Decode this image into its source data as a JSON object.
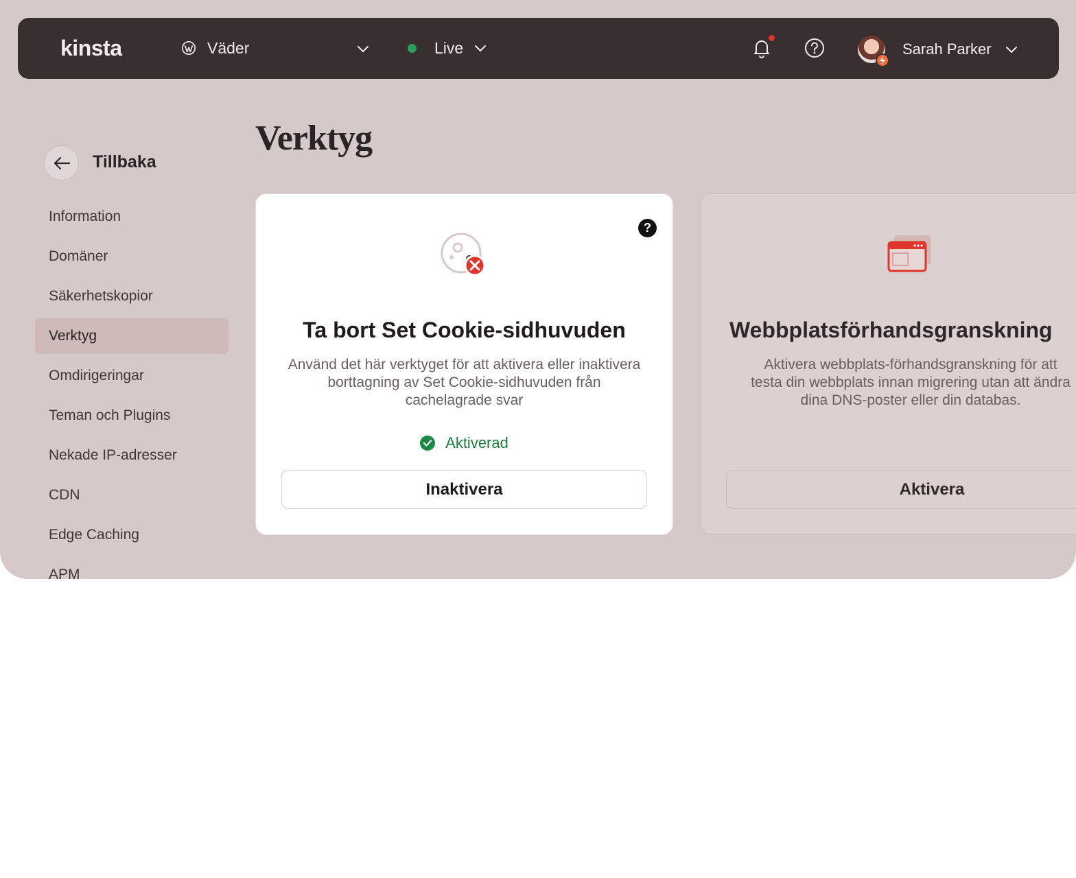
{
  "topbar": {
    "site_name": "Väder",
    "environment": "Live",
    "user_name": "Sarah Parker"
  },
  "sidebar": {
    "back_label": "Tillbaka",
    "items": [
      {
        "label": "Information"
      },
      {
        "label": "Domäner"
      },
      {
        "label": "Säkerhetskopior"
      },
      {
        "label": "Verktyg",
        "active": true
      },
      {
        "label": "Omdirigeringar"
      },
      {
        "label": "Teman och Plugins"
      },
      {
        "label": "Nekade IP-adresser"
      },
      {
        "label": "CDN"
      },
      {
        "label": "Edge Caching"
      },
      {
        "label": "APM"
      }
    ]
  },
  "main": {
    "title": "Verktyg",
    "cards": [
      {
        "title": "Ta bort Set Cookie-sidhuvuden",
        "description": "Använd det här verktyget för att aktivera eller inaktivera borttagning av Set Cookie-sidhuvuden från cachelagrade svar",
        "status": "Aktiverad",
        "button": "Inaktivera",
        "help": "?"
      },
      {
        "title": "Webbplatsförhandsgranskning",
        "description": "Aktivera webbplats-förhandsgranskning för att\ntesta din webbplats innan migrering utan att ändra\ndina DNS-poster eller din databas.",
        "button": "Aktivera"
      }
    ]
  },
  "colors": {
    "background": "#d6c9ca",
    "topbar": "#382f30",
    "accent": "#e0352b",
    "success": "#1c8a44"
  }
}
